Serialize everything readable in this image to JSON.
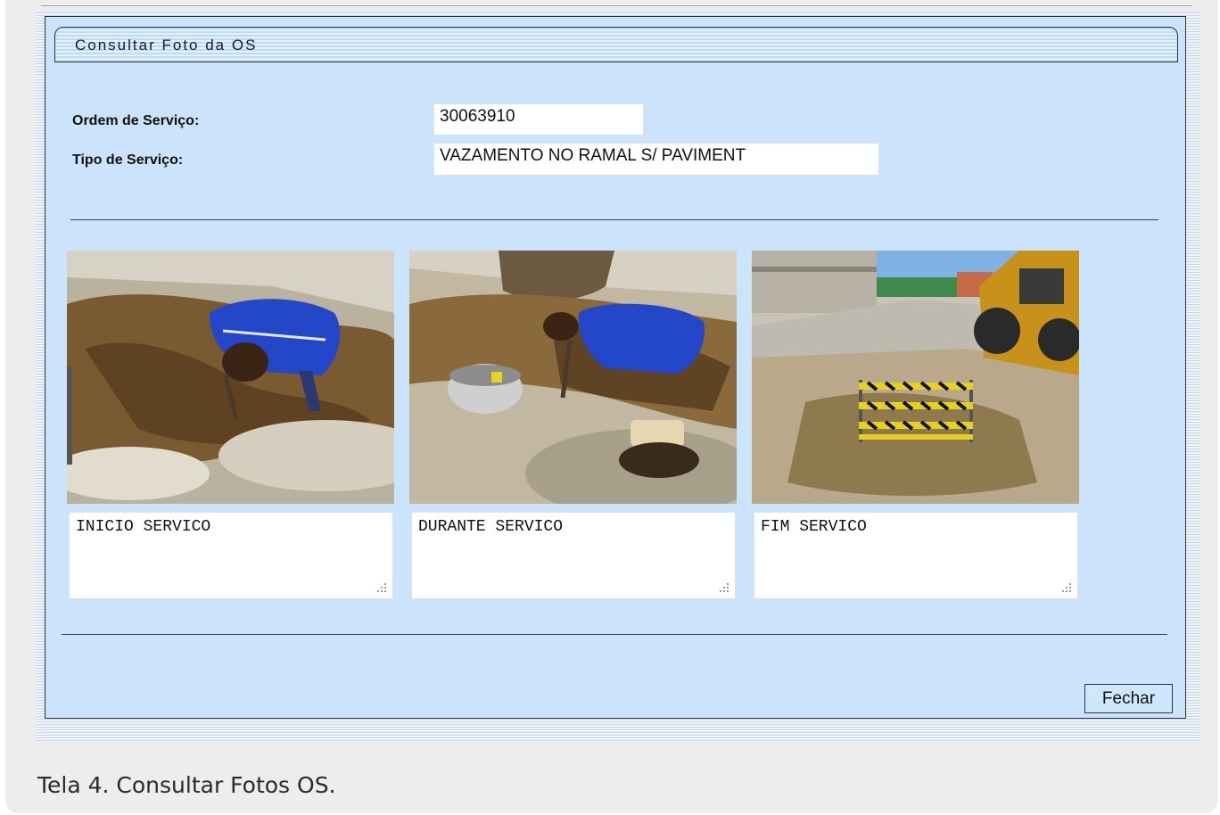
{
  "form": {
    "title": "Consultar Foto da OS",
    "ordem_label": "Ordem de Serviço:",
    "ordem_value": "30063910",
    "tipo_label": "Tipo de Serviço:",
    "tipo_value": "VAZAMENTO NO RAMAL S/ PAVIMENT"
  },
  "photos": [
    {
      "caption": "INICIO SERVICO"
    },
    {
      "caption": "DURANTE SERVICO"
    },
    {
      "caption": "FIM SERVICO"
    }
  ],
  "buttons": {
    "close_label": "Fechar"
  },
  "figure_caption": "Tela 4. Consultar Fotos OS.",
  "colors": {
    "form_bg": "#cce4fb",
    "border": "#2b3440",
    "worker_shirt": "#2446c8"
  },
  "icons": {
    "resize_grip": "resize-grip-icon"
  }
}
